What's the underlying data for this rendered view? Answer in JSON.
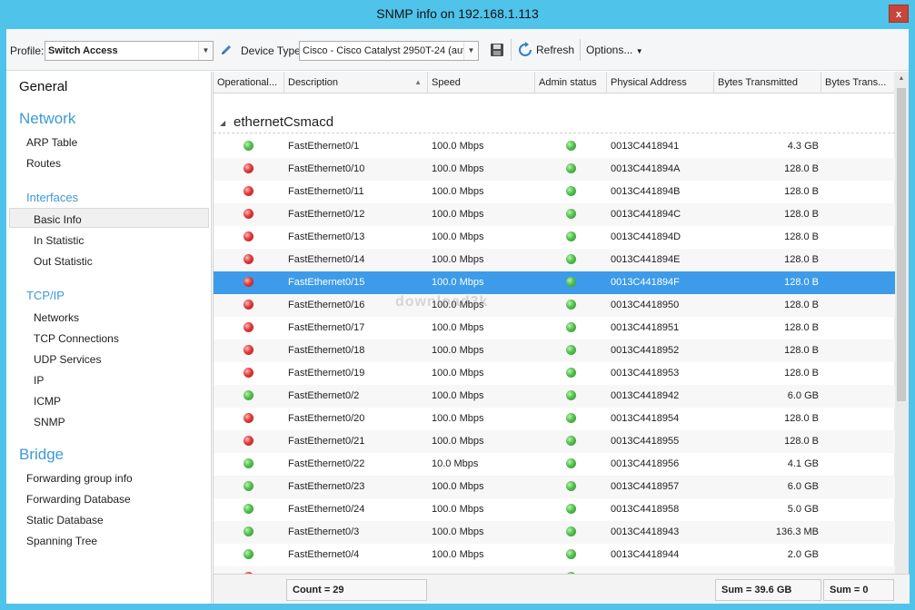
{
  "window": {
    "title": "SNMP info on 192.168.1.113",
    "close_glyph": "x"
  },
  "toolbar": {
    "profile_label": "Profile:",
    "profile_value": "Switch Access",
    "device_type_label": "Device Type:",
    "device_type_value": "Cisco - Cisco Catalyst 2950T-24 (aut",
    "refresh_label": "Refresh",
    "options_label": "Options..."
  },
  "nav": {
    "general": "General",
    "network": "Network",
    "network_items": [
      "ARP Table",
      "Routes"
    ],
    "interfaces": "Interfaces",
    "interfaces_items": [
      "Basic Info",
      "In Statistic",
      "Out Statistic"
    ],
    "tcpip": "TCP/IP",
    "tcpip_items": [
      "Networks",
      "TCP Connections",
      "UDP Services",
      "IP",
      "ICMP",
      "SNMP"
    ],
    "bridge": "Bridge",
    "bridge_items": [
      "Forwarding group info",
      "Forwarding Database",
      "Static Database",
      "Spanning Tree"
    ],
    "selected": "Basic Info"
  },
  "grid": {
    "columns": [
      "Operational...",
      "Description",
      "Speed",
      "Admin status",
      "Physical Address",
      "Bytes Transmitted",
      "Bytes Trans..."
    ],
    "group_name": "ethernetCsmacd",
    "rows": [
      {
        "op": "green",
        "desc": "FastEthernet0/1",
        "speed": "100.0 Mbps",
        "admin": "green",
        "mac": "0013C4418941",
        "bytes": "4.3 GB"
      },
      {
        "op": "red",
        "desc": "FastEthernet0/10",
        "speed": "100.0 Mbps",
        "admin": "green",
        "mac": "0013C441894A",
        "bytes": "128.0 B"
      },
      {
        "op": "red",
        "desc": "FastEthernet0/11",
        "speed": "100.0 Mbps",
        "admin": "green",
        "mac": "0013C441894B",
        "bytes": "128.0 B"
      },
      {
        "op": "red",
        "desc": "FastEthernet0/12",
        "speed": "100.0 Mbps",
        "admin": "green",
        "mac": "0013C441894C",
        "bytes": "128.0 B"
      },
      {
        "op": "red",
        "desc": "FastEthernet0/13",
        "speed": "100.0 Mbps",
        "admin": "green",
        "mac": "0013C441894D",
        "bytes": "128.0 B"
      },
      {
        "op": "red",
        "desc": "FastEthernet0/14",
        "speed": "100.0 Mbps",
        "admin": "green",
        "mac": "0013C441894E",
        "bytes": "128.0 B"
      },
      {
        "op": "red",
        "desc": "FastEthernet0/15",
        "speed": "100.0 Mbps",
        "admin": "green",
        "mac": "0013C441894F",
        "bytes": "128.0 B",
        "selected": true
      },
      {
        "op": "red",
        "desc": "FastEthernet0/16",
        "speed": "100.0 Mbps",
        "admin": "green",
        "mac": "0013C4418950",
        "bytes": "128.0 B"
      },
      {
        "op": "red",
        "desc": "FastEthernet0/17",
        "speed": "100.0 Mbps",
        "admin": "green",
        "mac": "0013C4418951",
        "bytes": "128.0 B"
      },
      {
        "op": "red",
        "desc": "FastEthernet0/18",
        "speed": "100.0 Mbps",
        "admin": "green",
        "mac": "0013C4418952",
        "bytes": "128.0 B"
      },
      {
        "op": "red",
        "desc": "FastEthernet0/19",
        "speed": "100.0 Mbps",
        "admin": "green",
        "mac": "0013C4418953",
        "bytes": "128.0 B"
      },
      {
        "op": "green",
        "desc": "FastEthernet0/2",
        "speed": "100.0 Mbps",
        "admin": "green",
        "mac": "0013C4418942",
        "bytes": "6.0 GB"
      },
      {
        "op": "red",
        "desc": "FastEthernet0/20",
        "speed": "100.0 Mbps",
        "admin": "green",
        "mac": "0013C4418954",
        "bytes": "128.0 B"
      },
      {
        "op": "red",
        "desc": "FastEthernet0/21",
        "speed": "100.0 Mbps",
        "admin": "green",
        "mac": "0013C4418955",
        "bytes": "128.0 B"
      },
      {
        "op": "green",
        "desc": "FastEthernet0/22",
        "speed": "10.0 Mbps",
        "admin": "green",
        "mac": "0013C4418956",
        "bytes": "4.1 GB"
      },
      {
        "op": "green",
        "desc": "FastEthernet0/23",
        "speed": "100.0 Mbps",
        "admin": "green",
        "mac": "0013C4418957",
        "bytes": "6.0 GB"
      },
      {
        "op": "green",
        "desc": "FastEthernet0/24",
        "speed": "100.0 Mbps",
        "admin": "green",
        "mac": "0013C4418958",
        "bytes": "5.0 GB"
      },
      {
        "op": "green",
        "desc": "FastEthernet0/3",
        "speed": "100.0 Mbps",
        "admin": "green",
        "mac": "0013C4418943",
        "bytes": "136.3 MB"
      },
      {
        "op": "green",
        "desc": "FastEthernet0/4",
        "speed": "100.0 Mbps",
        "admin": "green",
        "mac": "0013C4418944",
        "bytes": "2.0 GB"
      }
    ],
    "partial_row_op": "red",
    "partial_row_admin": "green"
  },
  "footer": {
    "count": "Count = 29",
    "sum_bytes": "Sum = 39.6 GB",
    "sum_other": "Sum = 0"
  },
  "watermark": "download3k",
  "colors": {
    "accent": "#3c9ad6",
    "selection": "#3d9be9",
    "titlebar": "#4fc3ea"
  },
  "icons": {
    "edit": "pencil-icon",
    "save": "floppy-icon",
    "refresh": "refresh-icon"
  }
}
